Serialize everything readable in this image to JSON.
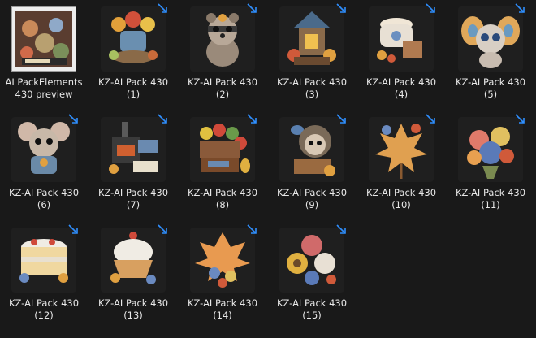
{
  "items": [
    {
      "line1": "AI PackElements",
      "line2": "430 preview",
      "icon": "preview-collage-icon",
      "shortcut": false,
      "bg": "#3a2e2a"
    },
    {
      "line1": "KZ-AI Pack 430",
      "line2": "(1)",
      "icon": "flower-teapot-icon",
      "shortcut": true,
      "bg": "#1f1f1f"
    },
    {
      "line1": "KZ-AI Pack 430",
      "line2": "(2)",
      "icon": "raccoon-icon",
      "shortcut": true,
      "bg": "#1f1f1f"
    },
    {
      "line1": "KZ-AI Pack 430",
      "line2": "(3)",
      "icon": "lantern-house-icon",
      "shortcut": true,
      "bg": "#1f1f1f"
    },
    {
      "line1": "KZ-AI Pack 430",
      "line2": "(4)",
      "icon": "teacup-icon",
      "shortcut": true,
      "bg": "#1f1f1f"
    },
    {
      "line1": "KZ-AI Pack 430",
      "line2": "(5)",
      "icon": "butterfly-creature-icon",
      "shortcut": true,
      "bg": "#1f1f1f"
    },
    {
      "line1": "KZ-AI Pack 430",
      "line2": "(6)",
      "icon": "mouse-icon",
      "shortcut": true,
      "bg": "#1f1f1f"
    },
    {
      "line1": "KZ-AI Pack 430",
      "line2": "(7)",
      "icon": "stove-icon",
      "shortcut": true,
      "bg": "#1f1f1f"
    },
    {
      "line1": "KZ-AI Pack 430",
      "line2": "(8)",
      "icon": "fruit-crate-icon",
      "shortcut": true,
      "bg": "#1f1f1f"
    },
    {
      "line1": "KZ-AI Pack 430",
      "line2": "(9)",
      "icon": "hedgehog-icon",
      "shortcut": true,
      "bg": "#1f1f1f"
    },
    {
      "line1": "KZ-AI Pack 430",
      "line2": "(10)",
      "icon": "maple-leaf-icon",
      "shortcut": true,
      "bg": "#1f1f1f"
    },
    {
      "line1": "KZ-AI Pack 430",
      "line2": "(11)",
      "icon": "flower-bouquet-icon",
      "shortcut": true,
      "bg": "#1f1f1f"
    },
    {
      "line1": "KZ-AI Pack 430",
      "line2": "(12)",
      "icon": "cake-slice-icon",
      "shortcut": true,
      "bg": "#1f1f1f"
    },
    {
      "line1": "KZ-AI Pack 430",
      "line2": "(13)",
      "icon": "cupcake-icon",
      "shortcut": true,
      "bg": "#1f1f1f"
    },
    {
      "line1": "KZ-AI Pack 430",
      "line2": "(14)",
      "icon": "autumn-leaves-icon",
      "shortcut": true,
      "bg": "#1f1f1f"
    },
    {
      "line1": "KZ-AI Pack 430",
      "line2": "(15)",
      "icon": "rose-cluster-icon",
      "shortcut": true,
      "bg": "#1f1f1f"
    }
  ],
  "colors": {
    "shortcut_arrow": "#2f8fff",
    "label": "#e8e8e8",
    "background": "#191919"
  }
}
